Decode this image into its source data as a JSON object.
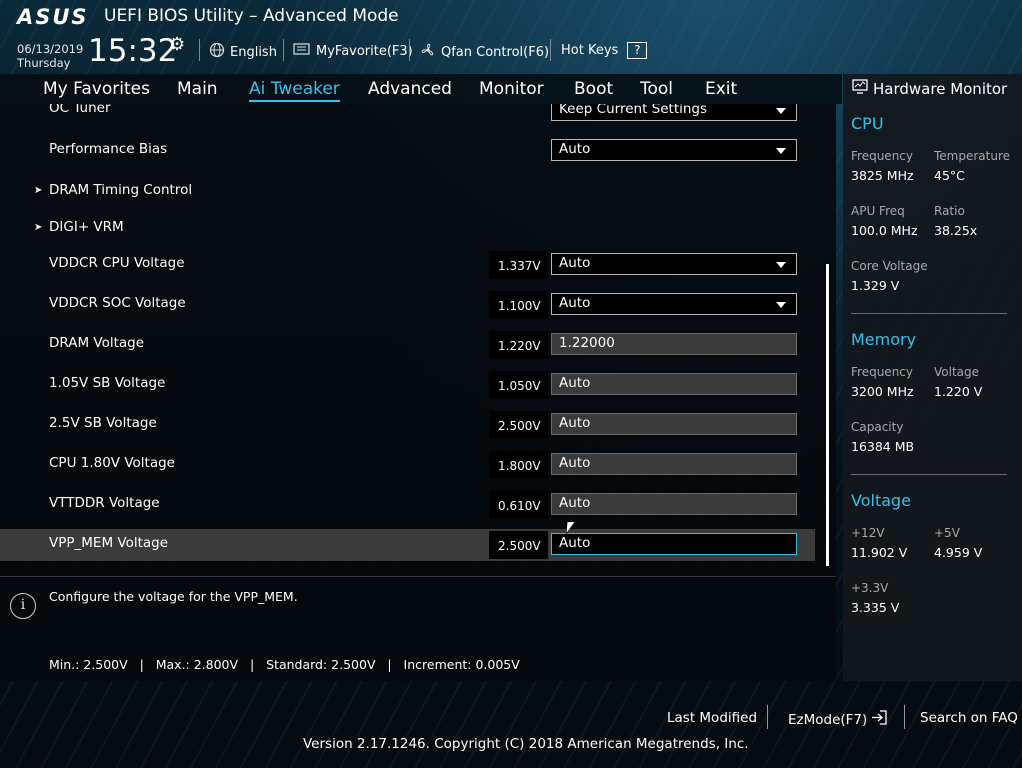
{
  "header": {
    "logo": "ASUS",
    "title": "UEFI BIOS Utility – Advanced Mode",
    "date": "06/13/2019",
    "weekday": "Thursday",
    "time": "15:32",
    "language": "English",
    "my_favorite": "MyFavorite(F3)",
    "qfan": "Qfan Control(F6)",
    "hot_keys": "Hot Keys",
    "hot_keys_glyph": "?"
  },
  "tabs": [
    {
      "label": "My Favorites",
      "active": false
    },
    {
      "label": "Main",
      "active": false
    },
    {
      "label": "Ai Tweaker",
      "active": true
    },
    {
      "label": "Advanced",
      "active": false
    },
    {
      "label": "Monitor",
      "active": false
    },
    {
      "label": "Boot",
      "active": false
    },
    {
      "label": "Tool",
      "active": false
    },
    {
      "label": "Exit",
      "active": false
    }
  ],
  "settings": [
    {
      "label": "OC Tuner",
      "value": "",
      "control": "dropdown",
      "control_value": "Keep Current Settings"
    },
    {
      "label": "Performance Bias",
      "value": "",
      "control": "dropdown",
      "control_value": "Auto"
    },
    {
      "label": "DRAM Timing Control",
      "submenu": true
    },
    {
      "label": "DIGI+ VRM",
      "submenu": true
    },
    {
      "label": "VDDCR CPU Voltage",
      "value": "1.337V",
      "control": "dropdown",
      "control_value": "Auto"
    },
    {
      "label": "VDDCR SOC Voltage",
      "value": "1.100V",
      "control": "dropdown",
      "control_value": "Auto"
    },
    {
      "label": "DRAM Voltage",
      "value": "1.220V",
      "control": "input",
      "control_value": "1.22000"
    },
    {
      "label": "1.05V SB Voltage",
      "value": "1.050V",
      "control": "input",
      "control_value": "Auto"
    },
    {
      "label": "2.5V SB Voltage",
      "value": "2.500V",
      "control": "input",
      "control_value": "Auto"
    },
    {
      "label": "CPU 1.80V Voltage",
      "value": "1.800V",
      "control": "input",
      "control_value": "Auto"
    },
    {
      "label": "VTTDDR Voltage",
      "value": "0.610V",
      "control": "input",
      "control_value": "Auto"
    },
    {
      "label": "VPP_MEM Voltage",
      "value": "2.500V",
      "control": "input",
      "control_value": "Auto",
      "selected": true
    }
  ],
  "submenu_marker": "➤",
  "help": {
    "text": "Configure the voltage for the VPP_MEM.",
    "limits": "Min.: 2.500V   |   Max.: 2.800V   |   Standard: 2.500V   |   Increment: 0.005V"
  },
  "hardware_monitor": {
    "title": "Hardware Monitor",
    "cpu": {
      "heading": "CPU",
      "frequency_label": "Frequency",
      "frequency": "3825 MHz",
      "temperature_label": "Temperature",
      "temperature": "45°C",
      "apu_label": "APU Freq",
      "apu": "100.0 MHz",
      "ratio_label": "Ratio",
      "ratio": "38.25x",
      "core_voltage_label": "Core Voltage",
      "core_voltage": "1.329 V"
    },
    "memory": {
      "heading": "Memory",
      "frequency_label": "Frequency",
      "frequency": "3200 MHz",
      "voltage_label": "Voltage",
      "voltage": "1.220 V",
      "capacity_label": "Capacity",
      "capacity": "16384 MB"
    },
    "voltage": {
      "heading": "Voltage",
      "v12_label": "+12V",
      "v12": "11.902 V",
      "v5_label": "+5V",
      "v5": "4.959 V",
      "v33_label": "+3.3V",
      "v33": "3.335 V"
    }
  },
  "footer": {
    "last_modified": "Last Modified",
    "ezmode": "EzMode(F7)",
    "faq": "Search on FAQ",
    "copyright": "Version 2.17.1246. Copyright (C) 2018 American Megatrends, Inc."
  },
  "colors": {
    "accent": "#38c0e8",
    "panel": "#04090d",
    "selected_row": "#3b3b3b"
  }
}
